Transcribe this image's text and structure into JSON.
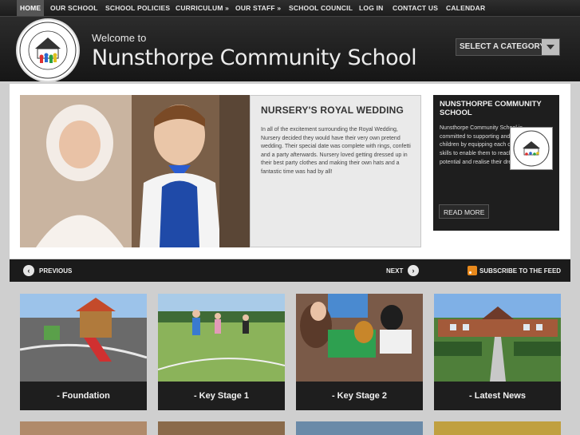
{
  "nav": {
    "items": [
      "HOME",
      "OUR SCHOOL",
      "SCHOOL POLICIES",
      "CURRICULUM »",
      "OUR STAFF »",
      "SCHOOL COUNCIL",
      "LOG IN",
      "CONTACT US",
      "CALENDAR"
    ]
  },
  "header": {
    "welcome": "Welcome to",
    "site_name": "Nunsthorpe Community School",
    "category_select": "SELECT A CATEGORY",
    "logo_text": "NUNSTHORPE COMMUNITY SCHOOL · PARTNERS IN PROGRESS"
  },
  "feature": {
    "title": "NURSERY'S ROYAL WEDDING",
    "body": "In all of the excitement surrounding the Royal Wedding, Nursery decided they would have their very own pretend wedding. Their special date was complete with rings, confetti and a party afterwards. Nursery loved getting dressed up in their best party clothes and making their own hats and a fantastic time was had by all!"
  },
  "sidebar": {
    "title": "NUNSTHORPE COMMUNITY SCHOOL",
    "body": "Nunsthorpe Community School is committed to supporting and inspiring our children by equipping each one with life skills to enable them to reach their full potential and realise their dreams.",
    "read_more": "READ MORE"
  },
  "pager": {
    "previous": "PREVIOUS",
    "next": "NEXT",
    "subscribe": "SUBSCRIBE TO THE FEED"
  },
  "tiles": [
    {
      "label": "- Foundation"
    },
    {
      "label": "- Key Stage 1"
    },
    {
      "label": "- Key Stage 2"
    },
    {
      "label": "- Latest News"
    }
  ],
  "colors": {
    "nav_bg": "#222222",
    "page_bg": "#cfcfcf",
    "caption_bg": "#1e1e1e",
    "rss": "#e8891c"
  },
  "icons": [
    "previous-arrow-icon",
    "next-arrow-icon",
    "rss-icon",
    "chevron-down-icon"
  ]
}
